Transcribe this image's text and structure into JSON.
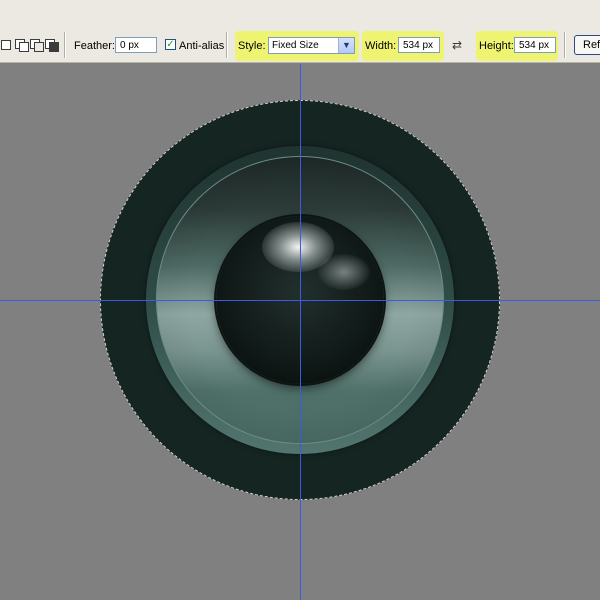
{
  "toolbar": {
    "feather_label": "Feather:",
    "feather_value": "0 px",
    "antialias_label": "Anti-alias",
    "antialias_checked": true,
    "style_label": "Style:",
    "style_value": "Fixed Size",
    "width_label": "Width:",
    "width_value": "534 px",
    "height_label": "Height:",
    "height_value": "534 px",
    "refine_label": "Refine Edge...",
    "selection_modes": [
      "new-selection-icon",
      "add-to-selection-icon",
      "subtract-from-selection-icon",
      "intersect-selection-icon"
    ],
    "highlight_color": "#eef472"
  },
  "canvas": {
    "background_color": "#808080",
    "guide_color": "#3a5be8"
  }
}
